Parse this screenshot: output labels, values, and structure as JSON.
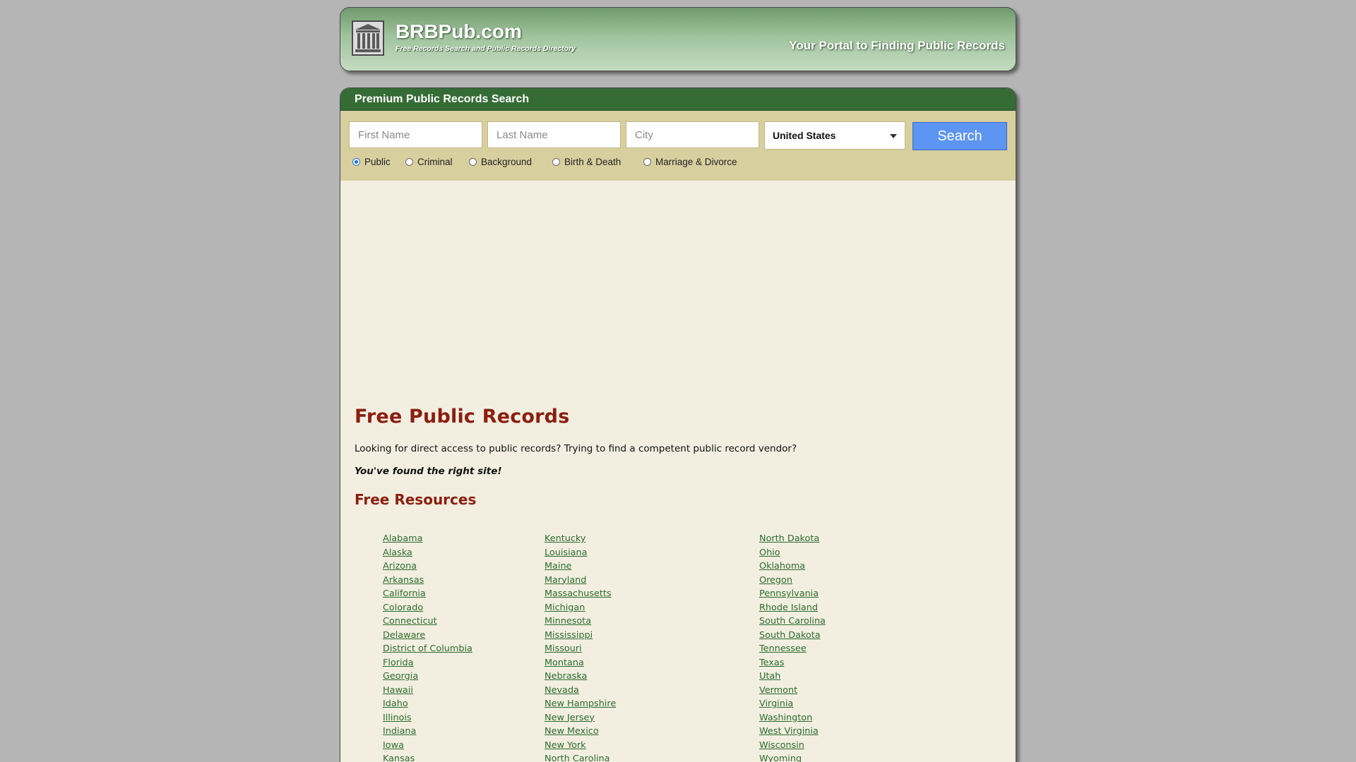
{
  "header": {
    "brand": "BRBPub.com",
    "tagline_small": "Free Records Search and Public Records Directory",
    "portal": "Your Portal to Finding Public Records"
  },
  "search_panel": {
    "title": "Premium Public Records Search",
    "first_name_placeholder": "First Name",
    "last_name_placeholder": "Last Name",
    "city_placeholder": "City",
    "country_selected": "United States",
    "search_label": "Search",
    "radios": [
      {
        "label": "Public",
        "checked": true
      },
      {
        "label": "Criminal",
        "checked": false
      },
      {
        "label": "Background",
        "checked": false
      },
      {
        "label": "Birth & Death",
        "checked": false
      },
      {
        "label": "Marriage & Divorce",
        "checked": false
      }
    ]
  },
  "content": {
    "title": "Free Public Records",
    "intro": "Looking for direct access to public records? Trying to find a competent public record vendor?",
    "found": "You've found the right site!",
    "resources_heading": "Free Resources",
    "states_col1": [
      "Alabama",
      "Alaska",
      "Arizona",
      "Arkansas",
      "California",
      "Colorado",
      "Connecticut",
      "Delaware",
      "District of Columbia",
      "Florida",
      "Georgia",
      "Hawaii",
      "Idaho",
      "Illinois",
      "Indiana",
      "Iowa",
      "Kansas"
    ],
    "states_col2": [
      "Kentucky",
      "Louisiana",
      "Maine",
      "Maryland",
      "Massachusetts",
      "Michigan",
      "Minnesota",
      "Mississippi",
      "Missouri",
      "Montana",
      "Nebraska",
      "Nevada",
      "New Hampshire",
      "New Jersey",
      "New Mexico",
      "New York",
      "North Carolina"
    ],
    "states_col3": [
      "North Dakota",
      "Ohio",
      "Oklahoma",
      "Oregon",
      "Pennsylvania",
      "Rhode Island",
      "South Carolina",
      "South Dakota",
      "Tennessee",
      "Texas",
      "Utah",
      "Vermont",
      "Virginia",
      "Washington",
      "West Virginia",
      "Wisconsin",
      "Wyoming"
    ]
  }
}
